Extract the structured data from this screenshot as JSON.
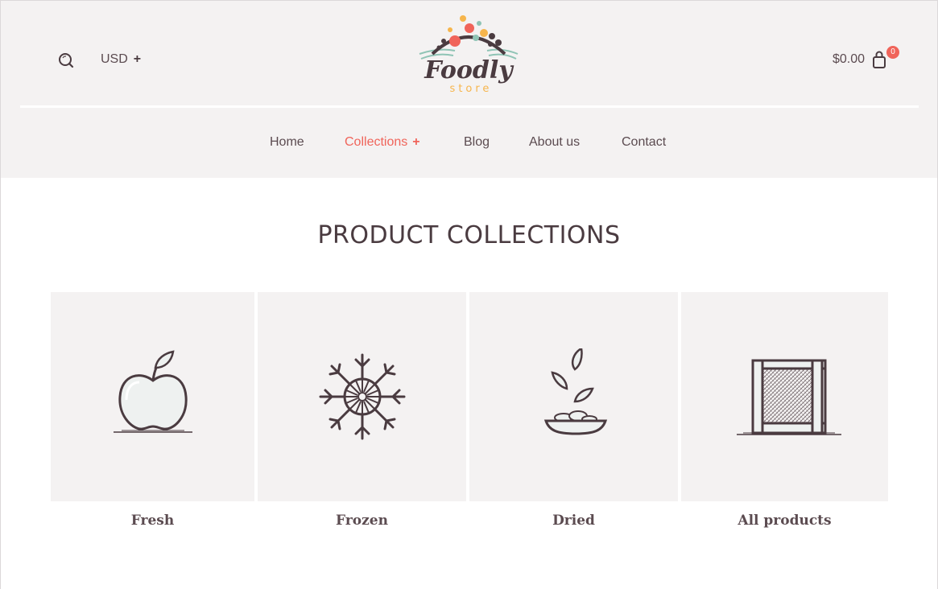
{
  "header": {
    "currency": "USD",
    "currency_toggle": "+",
    "logo": {
      "word": "Foodly",
      "sub": "store"
    },
    "cart_total": "$0.00",
    "cart_count": "0"
  },
  "nav": {
    "items": [
      {
        "label": "Home",
        "active": false
      },
      {
        "label": "Collections",
        "active": true,
        "expand": "+"
      },
      {
        "label": "Blog",
        "active": false
      },
      {
        "label": "About us",
        "active": false
      },
      {
        "label": "Contact",
        "active": false
      }
    ]
  },
  "main": {
    "title": "PRODUCT COLLECTIONS",
    "collections": [
      {
        "label": "Fresh",
        "icon": "apple-icon"
      },
      {
        "label": "Frozen",
        "icon": "snowflake-icon"
      },
      {
        "label": "Dried",
        "icon": "dried-leaves-bowl-icon"
      },
      {
        "label": "All products",
        "icon": "crate-icon"
      }
    ]
  },
  "colors": {
    "accent": "#f0645a",
    "text": "#5b4b50",
    "panel": "#f4f2f2"
  }
}
